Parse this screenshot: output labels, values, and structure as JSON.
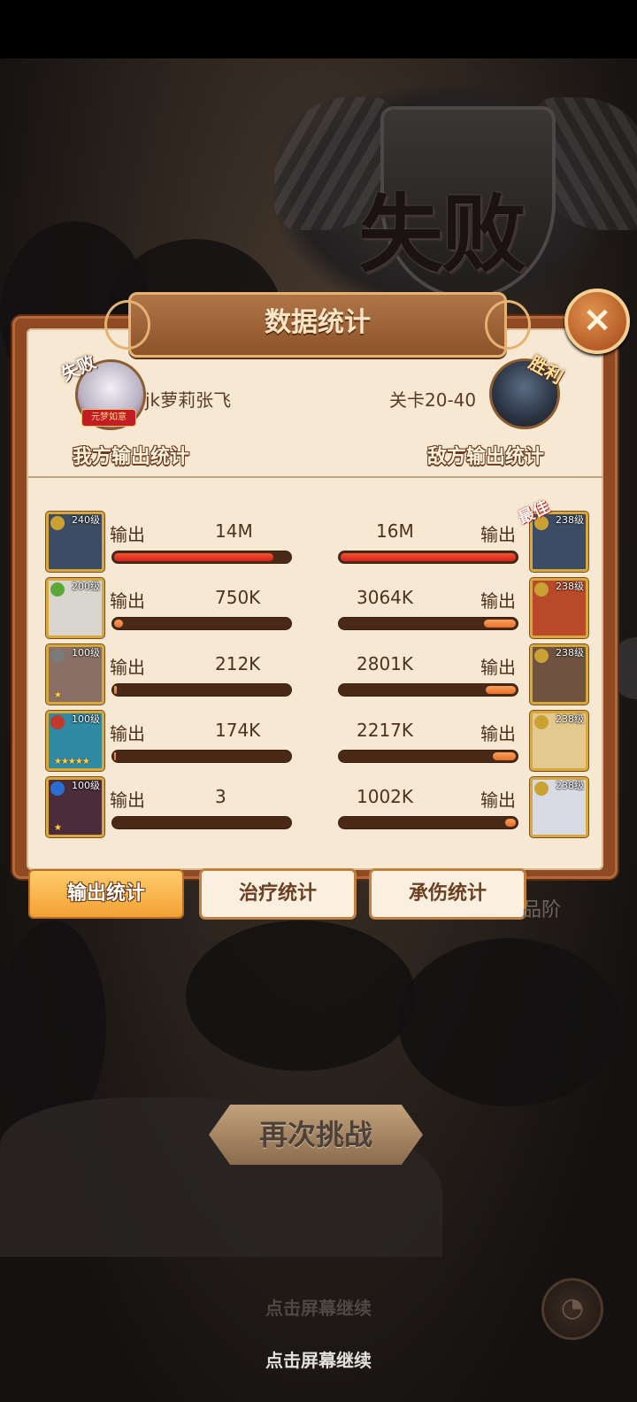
{
  "result": {
    "title": "失败"
  },
  "panel": {
    "title": "数据统计",
    "close_icon": "×",
    "player": {
      "name": "jk萝莉张飞",
      "stamp": "失败",
      "banner": "元梦如意"
    },
    "enemy": {
      "stage": "关卡20-40",
      "stamp": "胜利"
    },
    "headings": {
      "mine": "我方输出统计",
      "enemy": "敌方输出统计"
    },
    "output_label": "输出",
    "best_tag": "最佳",
    "rows": [
      {
        "left": {
          "level": "240级",
          "value": "14M",
          "bar": 0.91,
          "stars": "",
          "bg": "#3c4c64"
        },
        "right": {
          "level": "238级",
          "value": "16M",
          "bar": 1.0,
          "stars": "",
          "bg": "#3c4c64"
        }
      },
      {
        "left": {
          "level": "200级",
          "value": "750K",
          "bar": 0.05,
          "stars": "",
          "bg": "#d9d6d0"
        },
        "right": {
          "level": "238级",
          "value": "3064K",
          "bar": 0.18,
          "stars": "",
          "bg": "#b84a2a"
        }
      },
      {
        "left": {
          "level": "100级",
          "value": "212K",
          "bar": 0.015,
          "stars": "★",
          "bg": "#8a7064"
        },
        "right": {
          "level": "238级",
          "value": "2801K",
          "bar": 0.17,
          "stars": "",
          "bg": "#6d5340"
        }
      },
      {
        "left": {
          "level": "100级",
          "value": "174K",
          "bar": 0.01,
          "stars": "★★★★★",
          "bg": "#2f8aa3"
        },
        "right": {
          "level": "238级",
          "value": "2217K",
          "bar": 0.13,
          "stars": "",
          "bg": "#e3c98d"
        }
      },
      {
        "left": {
          "level": "100级",
          "value": "3",
          "bar": 0.0,
          "stars": "★",
          "bg": "#4a2c3a"
        },
        "right": {
          "level": "238级",
          "value": "1002K",
          "bar": 0.06,
          "stars": "",
          "bg": "#d9dbe4"
        }
      }
    ]
  },
  "tabs": [
    "输出统计",
    "治疗统计",
    "承伤统计"
  ],
  "background": {
    "faded_text": "品阶"
  },
  "retry_label": "再次挑战",
  "continue_text": "点击屏幕继续",
  "colors": {
    "accent": "#f3a133",
    "bar_fill": "#e9702b",
    "bar_best": "#d9221e",
    "panel": "#f6e8d2"
  }
}
